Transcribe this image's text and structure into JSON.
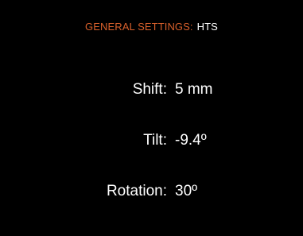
{
  "header": {
    "section": "GENERAL SETTINGS:",
    "mode": "HTS"
  },
  "settings": [
    {
      "label": "Shift:",
      "value": "5 mm"
    },
    {
      "label": "Tilt:",
      "value": "-9.4º"
    },
    {
      "label": "Rotation:",
      "value": "30º"
    }
  ],
  "colors": {
    "background": "#000000",
    "accent": "#d8602b",
    "text": "#ffffff"
  }
}
